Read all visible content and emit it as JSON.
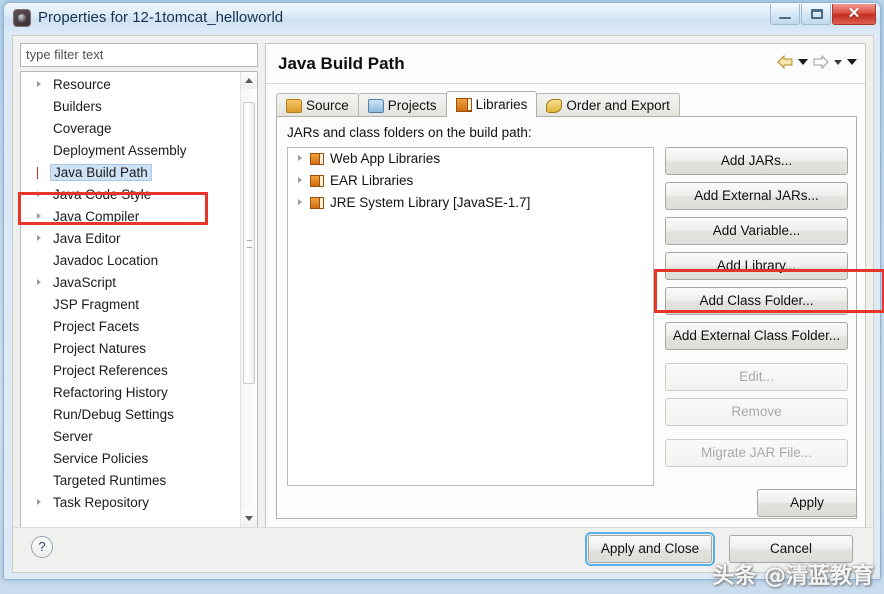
{
  "window": {
    "title": "Properties for 12-1tomcat_helloworld",
    "app_icon": "eclipse-icon",
    "controls": {
      "minimize": "minimize-icon",
      "maximize": "maximize-icon",
      "close": "✕"
    }
  },
  "filter": {
    "placeholder": "type filter text",
    "value": "type filter text"
  },
  "tree": {
    "items": [
      {
        "label": "Resource",
        "expandable": true,
        "selected": false
      },
      {
        "label": "Builders",
        "expandable": false,
        "selected": false
      },
      {
        "label": "Coverage",
        "expandable": false,
        "selected": false
      },
      {
        "label": "Deployment Assembly",
        "expandable": false,
        "selected": false
      },
      {
        "label": "Java Build Path",
        "expandable": true,
        "selected": true
      },
      {
        "label": "Java Code Style",
        "expandable": true,
        "selected": false
      },
      {
        "label": "Java Compiler",
        "expandable": true,
        "selected": false
      },
      {
        "label": "Java Editor",
        "expandable": true,
        "selected": false
      },
      {
        "label": "Javadoc Location",
        "expandable": false,
        "selected": false
      },
      {
        "label": "JavaScript",
        "expandable": true,
        "selected": false
      },
      {
        "label": "JSP Fragment",
        "expandable": false,
        "selected": false
      },
      {
        "label": "Project Facets",
        "expandable": false,
        "selected": false
      },
      {
        "label": "Project Natures",
        "expandable": false,
        "selected": false
      },
      {
        "label": "Project References",
        "expandable": false,
        "selected": false
      },
      {
        "label": "Refactoring History",
        "expandable": false,
        "selected": false
      },
      {
        "label": "Run/Debug Settings",
        "expandable": false,
        "selected": false
      },
      {
        "label": "Server",
        "expandable": false,
        "selected": false
      },
      {
        "label": "Service Policies",
        "expandable": false,
        "selected": false
      },
      {
        "label": "Targeted Runtimes",
        "expandable": false,
        "selected": false
      },
      {
        "label": "Task Repository",
        "expandable": true,
        "selected": false
      }
    ]
  },
  "page": {
    "title": "Java Build Path",
    "nav": {
      "back": "back-arrow-icon",
      "back_menu": "chevron-down-icon",
      "forward": "forward-arrow-icon",
      "forward_menu": "chevron-down-icon",
      "more_menu": "chevron-down-icon"
    }
  },
  "tabs": [
    {
      "label": "Source",
      "icon": "source-folder-icon",
      "active": false
    },
    {
      "label": "Projects",
      "icon": "projects-folder-icon",
      "active": false
    },
    {
      "label": "Libraries",
      "icon": "libraries-icon",
      "active": true
    },
    {
      "label": "Order and Export",
      "icon": "order-export-icon",
      "active": false
    }
  ],
  "libraries_tab": {
    "list_label": "JARs and class folders on the build path:",
    "entries": [
      {
        "label": "Web App Libraries",
        "icon": "library-icon",
        "expandable": true
      },
      {
        "label": "EAR Libraries",
        "icon": "library-icon",
        "expandable": true
      },
      {
        "label": "JRE System Library [JavaSE-1.7]",
        "icon": "library-icon",
        "expandable": true
      }
    ],
    "buttons": [
      {
        "label": "Add JARs...",
        "enabled": true,
        "highlighted": false
      },
      {
        "label": "Add External JARs...",
        "enabled": true,
        "highlighted": false
      },
      {
        "label": "Add Variable...",
        "enabled": true,
        "highlighted": false
      },
      {
        "label": "Add Library...",
        "enabled": true,
        "highlighted": true
      },
      {
        "label": "Add Class Folder...",
        "enabled": true,
        "highlighted": false
      },
      {
        "label": "Add External Class Folder...",
        "enabled": true,
        "highlighted": false
      },
      {
        "label": "Edit...",
        "enabled": false,
        "highlighted": false
      },
      {
        "label": "Remove",
        "enabled": false,
        "highlighted": false
      },
      {
        "label": "Migrate JAR File...",
        "enabled": false,
        "highlighted": false
      }
    ],
    "apply_label": "Apply"
  },
  "footer": {
    "help": "?",
    "ok_label": "Apply and Close",
    "cancel_label": "Cancel"
  },
  "annotations": {
    "color": "#e8352a",
    "targets": [
      "Java Build Path",
      "Add Library..."
    ]
  },
  "watermark": "头条 @清蓝教育"
}
